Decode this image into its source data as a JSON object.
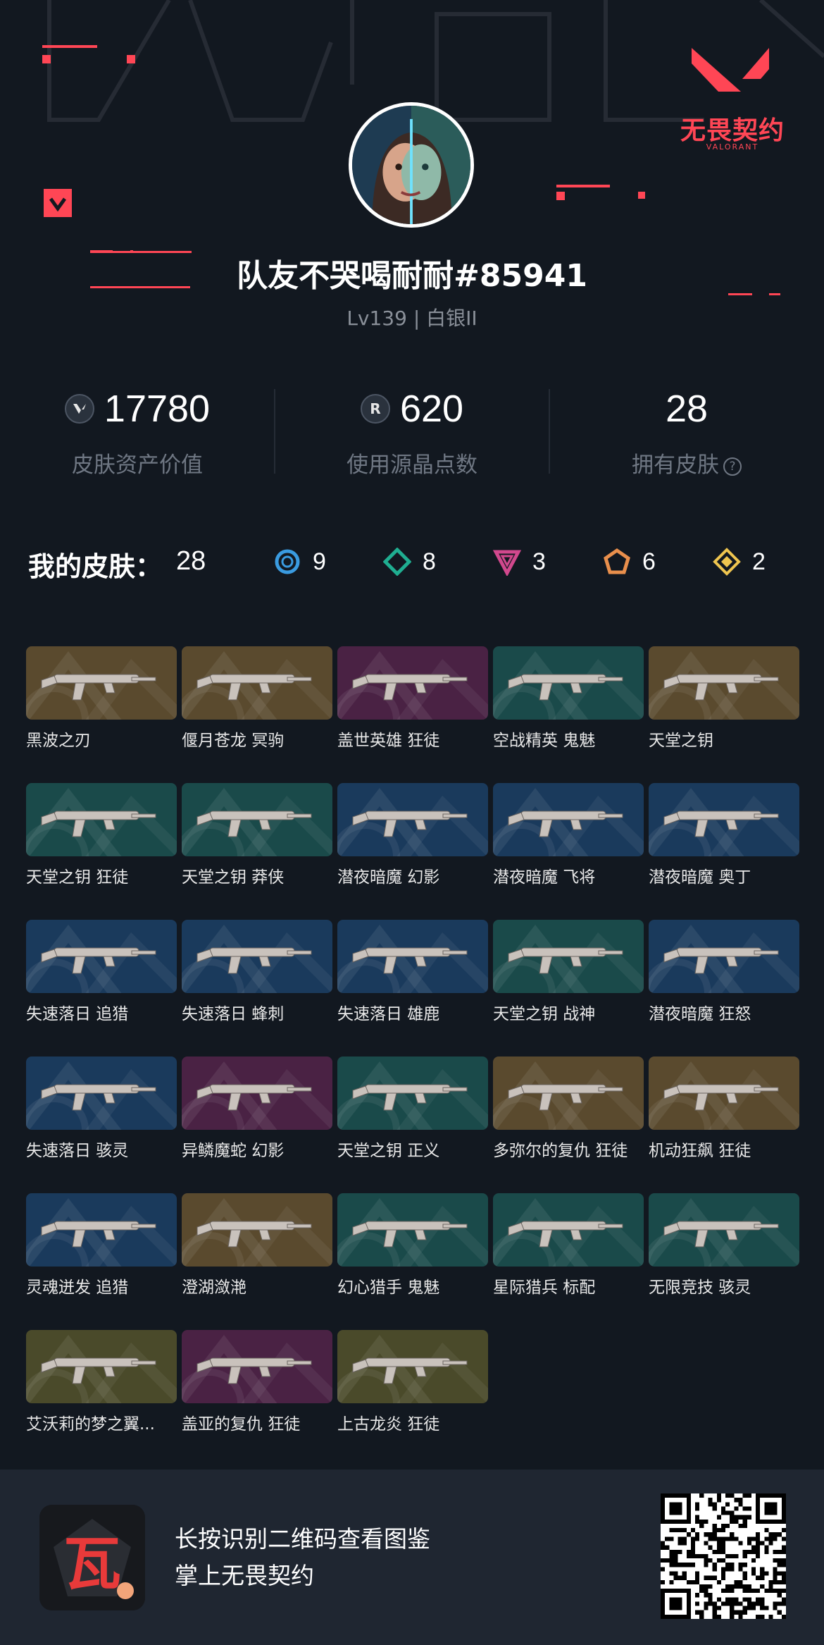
{
  "brand": {
    "name": "无畏契约",
    "sub": "VALORANT"
  },
  "profile": {
    "username": "队友不哭喝耐耐#85941",
    "level": "Lv139 | 白银II"
  },
  "stats": [
    {
      "icon": "valorant-points-icon",
      "value": "17780",
      "label": "皮肤资产价值"
    },
    {
      "icon": "radianite-points-icon",
      "value": "620",
      "label": "使用源晶点数"
    },
    {
      "icon": "",
      "value": "28",
      "label": "拥有皮肤"
    }
  ],
  "skins_header": {
    "title": "我的皮肤：",
    "total": "28",
    "tiers": [
      {
        "icon": "select-tier-icon",
        "color": "#3a9be0",
        "count": "9"
      },
      {
        "icon": "deluxe-tier-icon",
        "color": "#1fae91",
        "count": "8"
      },
      {
        "icon": "premium-tier-icon",
        "color": "#d1488d",
        "count": "3"
      },
      {
        "icon": "exclusive-tier-icon",
        "color": "#e98f4c",
        "count": "6"
      },
      {
        "icon": "ultra-tier-icon",
        "color": "#efc54f",
        "count": "2"
      }
    ]
  },
  "tier_colors": {
    "gold": "#5a4a2e",
    "teal": "#1a4a4a",
    "blue": "#1a3a5c",
    "purple": "#4a2244",
    "olive": "#4a4a2a"
  },
  "skins": [
    {
      "name": "黑波之刃",
      "tier": "gold"
    },
    {
      "name": "偃月苍龙 冥驹",
      "tier": "gold"
    },
    {
      "name": "盖世英雄 狂徒",
      "tier": "purple"
    },
    {
      "name": "空战精英 鬼魅",
      "tier": "teal"
    },
    {
      "name": "天堂之钥",
      "tier": "gold"
    },
    {
      "name": "天堂之钥 狂徒",
      "tier": "teal"
    },
    {
      "name": "天堂之钥 莽侠",
      "tier": "teal"
    },
    {
      "name": "潜夜暗魔 幻影",
      "tier": "blue"
    },
    {
      "name": "潜夜暗魔 飞将",
      "tier": "blue"
    },
    {
      "name": "潜夜暗魔 奥丁",
      "tier": "blue"
    },
    {
      "name": "失速落日 追猎",
      "tier": "blue"
    },
    {
      "name": "失速落日 蜂刺",
      "tier": "blue"
    },
    {
      "name": "失速落日 雄鹿",
      "tier": "blue"
    },
    {
      "name": "天堂之钥 战神",
      "tier": "teal"
    },
    {
      "name": "潜夜暗魔 狂怒",
      "tier": "blue"
    },
    {
      "name": "失速落日 骇灵",
      "tier": "blue"
    },
    {
      "name": "异鳞魔蛇 幻影",
      "tier": "purple"
    },
    {
      "name": "天堂之钥 正义",
      "tier": "teal"
    },
    {
      "name": "多弥尔的复仇 狂徒",
      "tier": "gold"
    },
    {
      "name": "机动狂飙 狂徒",
      "tier": "gold"
    },
    {
      "name": "灵魂迸发 追猎",
      "tier": "blue"
    },
    {
      "name": "澄湖潋滟",
      "tier": "gold"
    },
    {
      "name": "幻心猎手 鬼魅",
      "tier": "teal"
    },
    {
      "name": "星际猎兵 标配",
      "tier": "teal"
    },
    {
      "name": "无限竞技 骇灵",
      "tier": "teal"
    },
    {
      "name": "艾沃莉的梦之翼...",
      "tier": "olive"
    },
    {
      "name": "盖亚的复仇 狂徒",
      "tier": "purple"
    },
    {
      "name": "上古龙炎 狂徒",
      "tier": "olive"
    }
  ],
  "footer": {
    "line1": "长按识别二维码查看图鉴",
    "line2": "掌上无畏契约",
    "app_icon_glyph": "瓦"
  }
}
